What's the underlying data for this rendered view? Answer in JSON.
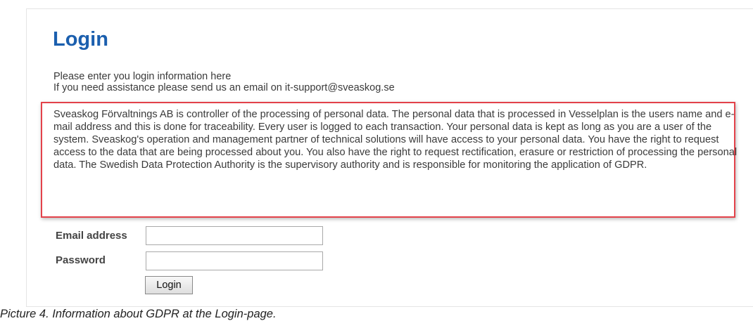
{
  "page": {
    "title": "Login",
    "intro_line1": "Please enter you login information here",
    "intro_line2": "If you need assistance please send us an email on it-support@sveaskog.se"
  },
  "gdpr": {
    "text": "Sveaskog Förvaltnings AB is controller of the processing of personal data. The personal data that is processed in Vesselplan is the users name and e-mail address and this is done for traceability. Every user is logged to each transaction. Your personal data is kept as long as you are a user of the system. Sveaskog's operation and management partner of technical solutions will have access to your personal data. You have the right to request access to the data that are being processed about you. You also have the right to request rectification, erasure or restriction of processing the personal data. The Swedish Data Protection Authority is the supervisory authority and is responsible for monitoring the application of GDPR.",
    "highlight_color": "#e3424a"
  },
  "form": {
    "email_label": "Email address",
    "email_value": "",
    "password_label": "Password",
    "password_value": "",
    "login_button": "Login"
  },
  "caption": "Picture 4. Information about GDPR at the Login-page.",
  "colors": {
    "title": "#1b5fae",
    "text": "#3a3a3a"
  }
}
